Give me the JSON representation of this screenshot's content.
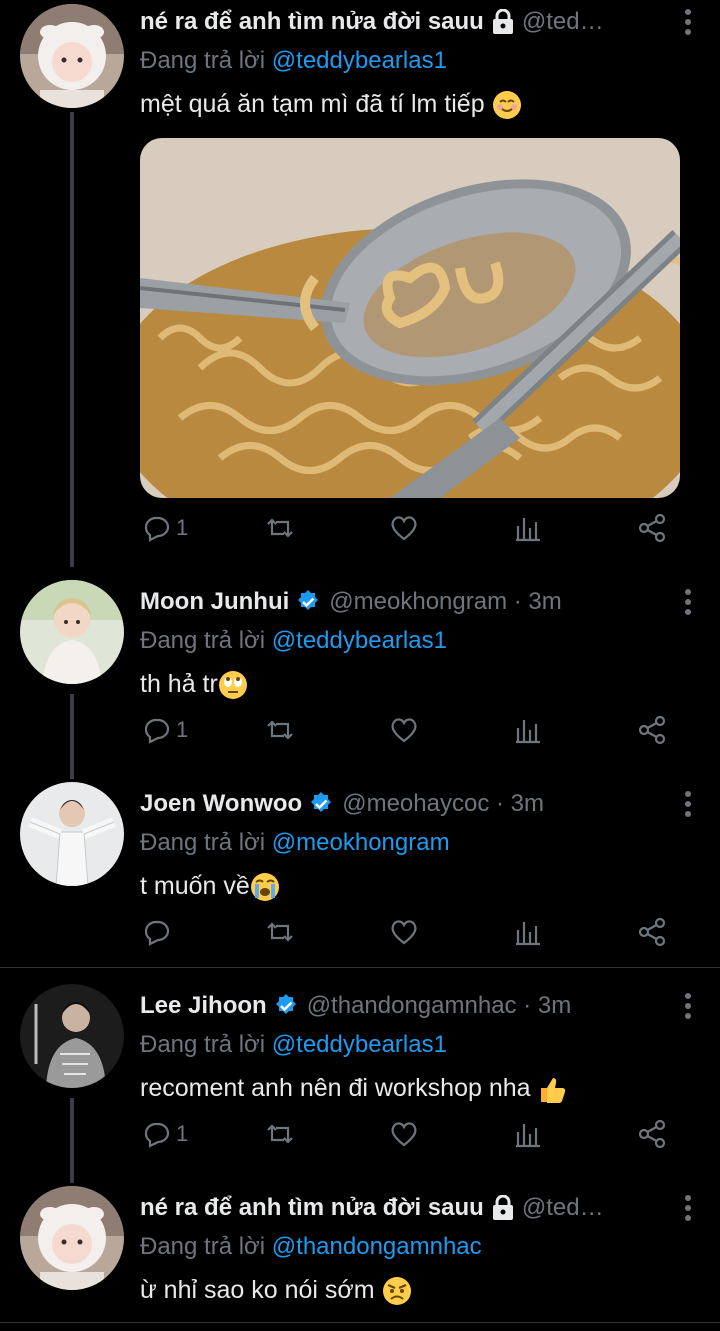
{
  "tweets": [
    {
      "name": "né ra để anh tìm nửa đời sauu",
      "handle": "@ted…",
      "reply_label": "Đang trả lời",
      "reply_to": "@teddybearlas1",
      "text": "mệt quá ăn tạm mì đã tí lm tiếp",
      "emoji": "relieved-smile-emoji",
      "has_image": true,
      "reply_count": "1",
      "protected": true
    },
    {
      "name": "Moon Junhui",
      "handle": "@meokhongram · 3m",
      "reply_label": "Đang trả lời",
      "reply_to": "@teddybearlas1",
      "text": "th hả tr",
      "emoji": "eye-roll-emoji",
      "reply_count": "1",
      "verified": true
    },
    {
      "name": "Joen Wonwoo",
      "handle": "@meohaycoc · 3m",
      "reply_label": "Đang trả lời",
      "reply_to": "@meokhongram",
      "text": "t muốn về",
      "emoji": "crying-emoji",
      "reply_count": "",
      "verified": true
    },
    {
      "name": "Lee Jihoon",
      "handle": "@thandongamnhac · 3m",
      "reply_label": "Đang trả lời",
      "reply_to": "@teddybearlas1",
      "text": "recoment anh nên đi workshop nha",
      "emoji": "thumbs-up-emoji",
      "reply_count": "1",
      "verified": true
    },
    {
      "name": "né ra để anh tìm nửa đời sauu",
      "handle": "@ted…",
      "reply_label": "Đang trả lời",
      "reply_to": "@thandongamnhac",
      "text": "ừ nhỉ sao ko nói sớm",
      "emoji": "angry-face-emoji",
      "protected": true
    }
  ],
  "colors": {
    "background": "#000000",
    "text": "#e7e9ea",
    "muted": "#6e767d",
    "accent": "#1d9bf0"
  }
}
